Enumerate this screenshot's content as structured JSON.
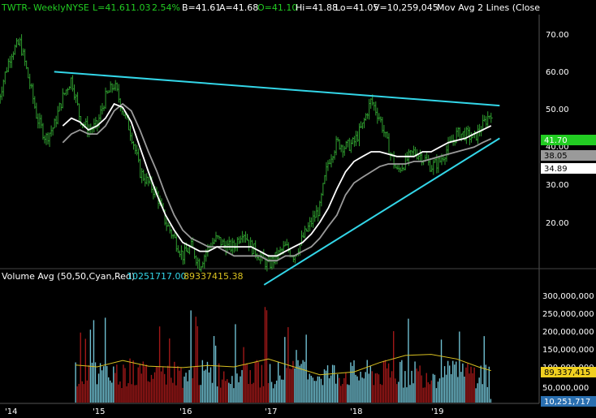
{
  "header": {
    "symbol": "TWTR",
    "period": "Weekly",
    "exchange": "NYSE",
    "last": "L=41.61",
    "change": "1.03",
    "change_pct": "2.54%",
    "bid": "B=41.61",
    "ask": "A=41.68",
    "open": "O=41.10",
    "high": "Hi=41.88",
    "low": "Lo=41.05",
    "volume": "V=10,259,045",
    "study": "Mov Avg 2 Lines (Close"
  },
  "volume_header": {
    "title": "Volume Avg (50,50,Cyan,Red)",
    "value1": "10251717.00",
    "value2": "89337415.38"
  },
  "colors": {
    "background": "#000000",
    "up_bar": "#2f9e2f",
    "ma_fast": "#ffffff",
    "ma_slow": "#9a9a9a",
    "trendline": "#33d6e8",
    "vol_up": "#6fbfd0",
    "vol_down": "#a01818",
    "vol_avg": "#d8c020",
    "price_tag": "#22cc22",
    "label_orange": "#f0a020"
  },
  "price_tags": {
    "last": "41.70",
    "ma1": "38.05",
    "ma2": "34.89"
  },
  "volume_tags": {
    "avg": "89,337,415",
    "last": "10,251,717"
  },
  "chart_data": {
    "type": "line",
    "title": "",
    "x_tick_labels": [
      "'14",
      "'15",
      "'16",
      "'17",
      "'18",
      "'19"
    ],
    "price_axis": {
      "ticks": [
        "70.00",
        "60.00",
        "50.00",
        "40.00",
        "30.00",
        "20.00"
      ],
      "range": [
        10,
        76
      ],
      "scale": "log"
    },
    "volume_axis": {
      "ticks": [
        "300,000,000",
        "250,000,000",
        "200,000,000",
        "150,000,000",
        "100,000,000",
        "50,000,000"
      ],
      "range": [
        0,
        350000000
      ]
    },
    "price_weekly_close": {
      "t": [
        2013.85,
        2014.0,
        2014.1,
        2014.2,
        2014.3,
        2014.4,
        2014.5,
        2014.6,
        2014.7,
        2014.8,
        2014.9,
        2015.0,
        2015.1,
        2015.2,
        2015.3,
        2015.4,
        2015.5,
        2015.6,
        2015.7,
        2015.8,
        2015.9,
        2016.0,
        2016.1,
        2016.2,
        2016.3,
        2016.4,
        2016.5,
        2016.6,
        2016.7,
        2016.8,
        2016.9,
        2017.0,
        2017.1,
        2017.2,
        2017.3,
        2017.4,
        2017.5,
        2017.6,
        2017.7,
        2017.8,
        2017.9,
        2018.0,
        2018.1,
        2018.2,
        2018.3,
        2018.4,
        2018.5,
        2018.6,
        2018.7,
        2018.8,
        2018.9,
        2019.0,
        2019.1,
        2019.2,
        2019.3,
        2019.4,
        2019.5,
        2019.6
      ],
      "close": [
        45,
        62,
        66,
        52,
        40,
        35,
        38,
        46,
        52,
        40,
        37,
        38,
        46,
        50,
        42,
        36,
        28,
        26,
        24,
        20,
        18,
        16,
        17,
        15,
        17,
        18,
        17,
        17,
        19,
        17,
        16,
        15,
        16,
        17,
        16,
        18,
        20,
        22,
        30,
        34,
        33,
        34,
        38,
        45,
        40,
        33,
        28,
        30,
        32,
        31,
        29,
        30,
        33,
        36,
        36,
        35,
        38,
        41.7
      ]
    },
    "ma_fast": {
      "name": "",
      "t": [
        2014.6,
        2014.7,
        2014.8,
        2014.9,
        2015.0,
        2015.1,
        2015.2,
        2015.3,
        2015.4,
        2015.5,
        2015.6,
        2015.7,
        2015.8,
        2015.9,
        2016.0,
        2016.1,
        2016.2,
        2016.3,
        2016.4,
        2016.5,
        2016.6,
        2016.7,
        2016.8,
        2016.9,
        2017.0,
        2017.1,
        2017.2,
        2017.3,
        2017.4,
        2017.5,
        2017.6,
        2017.7,
        2017.8,
        2017.9,
        2018.0,
        2018.1,
        2018.2,
        2018.3,
        2018.4,
        2018.5,
        2018.6,
        2018.7,
        2018.8,
        2018.9,
        2019.0,
        2019.1,
        2019.2,
        2019.3,
        2019.4,
        2019.5,
        2019.6
      ],
      "values": [
        38,
        40,
        39,
        37,
        38,
        40,
        44,
        43,
        39,
        33,
        28,
        24,
        21,
        19,
        17.5,
        17,
        16.5,
        16.5,
        17,
        17,
        17,
        17,
        17,
        16.5,
        16,
        16,
        16.5,
        17,
        17.5,
        18.5,
        20,
        22,
        25,
        28,
        30,
        31,
        32,
        32,
        31.5,
        31,
        31,
        31,
        32,
        32,
        33,
        34,
        34.5,
        35,
        36,
        37,
        38.05
      ]
    },
    "ma_slow": {
      "name": "",
      "t": [
        2014.6,
        2014.7,
        2014.8,
        2014.9,
        2015.0,
        2015.1,
        2015.2,
        2015.3,
        2015.4,
        2015.5,
        2015.6,
        2015.7,
        2015.8,
        2015.9,
        2016.0,
        2016.1,
        2016.2,
        2016.3,
        2016.4,
        2016.5,
        2016.6,
        2016.7,
        2016.8,
        2016.9,
        2017.0,
        2017.1,
        2017.2,
        2017.3,
        2017.4,
        2017.5,
        2017.6,
        2017.7,
        2017.8,
        2017.9,
        2018.0,
        2018.1,
        2018.2,
        2018.3,
        2018.4,
        2018.5,
        2018.6,
        2018.7,
        2018.8,
        2018.9,
        2019.0,
        2019.1,
        2019.2,
        2019.3,
        2019.4,
        2019.5,
        2019.6
      ],
      "values": [
        34,
        36,
        37,
        36,
        36,
        38,
        42,
        44,
        42,
        37,
        32,
        28,
        24,
        21,
        19,
        18,
        17.5,
        17,
        17,
        16.5,
        16,
        16,
        16,
        16,
        15.5,
        15.5,
        16,
        16,
        16.5,
        17,
        18,
        19.5,
        21,
        24,
        26,
        27,
        28,
        29,
        29.5,
        29.5,
        29.5,
        30,
        30,
        30.5,
        31,
        31.5,
        32,
        32.5,
        33,
        34,
        34.89
      ]
    },
    "trendline_upper": {
      "t": [
        2014.5,
        2019.7
      ],
      "values": [
        54.5,
        43.5
      ]
    },
    "trendline_lower": {
      "t": [
        2016.95,
        2019.7
      ],
      "values": [
        13.2,
        35.0
      ]
    },
    "volume_avg_last": 89337415.38,
    "volume_last": 10251717
  }
}
